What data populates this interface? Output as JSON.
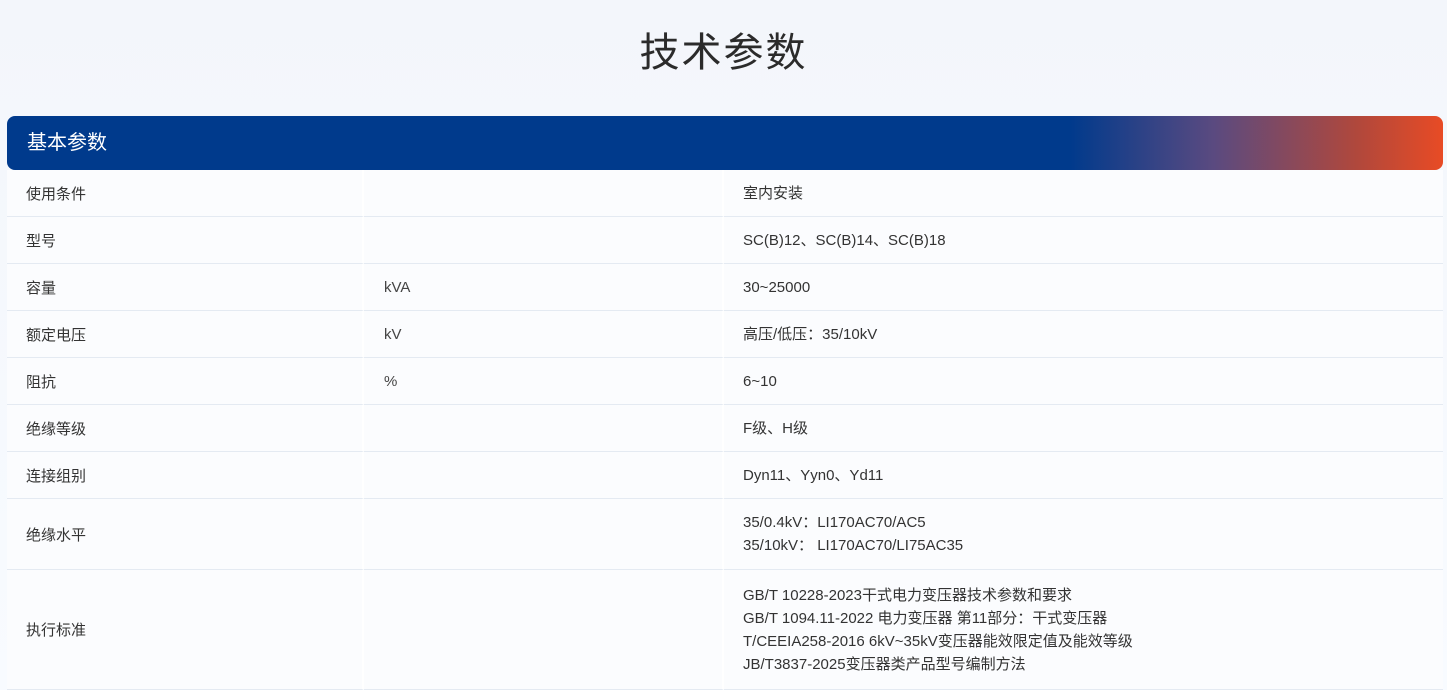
{
  "page_title": "技术参数",
  "section": {
    "title": "基本参数"
  },
  "rows": [
    {
      "name": "使用条件",
      "unit": "",
      "values": [
        "室内安装"
      ]
    },
    {
      "name": "型号",
      "unit": "",
      "values": [
        "SC(B)12、SC(B)14、SC(B)18"
      ]
    },
    {
      "name": "容量",
      "unit": "kVA",
      "values": [
        "30~25000"
      ]
    },
    {
      "name": "额定电压",
      "unit": "kV",
      "values": [
        "高压/低压：35/10kV"
      ]
    },
    {
      "name": "阻抗",
      "unit": "%",
      "values": [
        "6~10"
      ]
    },
    {
      "name": "绝缘等级",
      "unit": "",
      "values": [
        "F级、H级"
      ]
    },
    {
      "name": "连接组别",
      "unit": "",
      "values": [
        "Dyn11、Yyn0、Yd11"
      ]
    },
    {
      "name": "绝缘水平",
      "unit": "",
      "values": [
        "35/0.4kV：LI170AC70/AC5",
        "35/10kV： LI170AC70/LI75AC35"
      ]
    },
    {
      "name": "执行标准",
      "unit": "",
      "values": [
        "GB/T 10228-2023干式电力变压器技术参数和要求",
        "GB/T 1094.11-2022 电力变压器 第11部分：干式变压器",
        "T/CEEIA258-2016 6kV~35kV变压器能效限定值及能效等级",
        "JB/T3837-2025变压器类产品型号编制方法"
      ]
    }
  ],
  "colors": {
    "header_blue": "#003a8c",
    "header_orange": "#e84b25"
  }
}
